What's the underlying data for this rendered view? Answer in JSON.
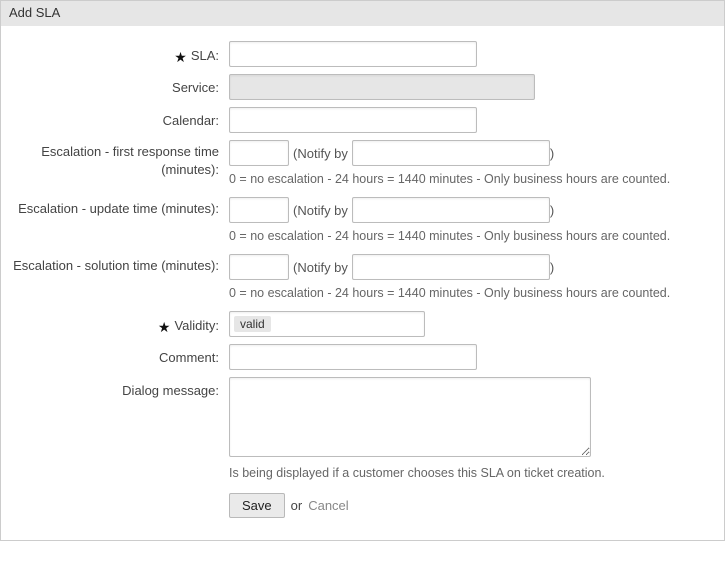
{
  "header": {
    "title": "Add SLA"
  },
  "labels": {
    "sla": "SLA:",
    "service": "Service:",
    "calendar": "Calendar:",
    "esc_first": "Escalation - first response time (minutes):",
    "esc_update": "Escalation - update time (minutes):",
    "esc_solution": "Escalation - solution time (minutes):",
    "validity": "Validity:",
    "comment": "Comment:",
    "dialog_message": "Dialog message:"
  },
  "values": {
    "sla": "",
    "service": "",
    "calendar": "",
    "esc_first_minutes": "",
    "esc_first_notify": "",
    "esc_update_minutes": "",
    "esc_update_notify": "",
    "esc_solution_minutes": "",
    "esc_solution_notify": "",
    "validity": "valid",
    "comment": "",
    "dialog_message": ""
  },
  "inline": {
    "notify_open": "(",
    "notify_label": "Notify by",
    "notify_close": ")"
  },
  "help": {
    "escalation": "0 = no escalation - 24 hours = 1440 minutes - Only business hours are counted.",
    "dialog_message": "Is being displayed if a customer chooses this SLA on ticket creation."
  },
  "actions": {
    "save": "Save",
    "or": "or",
    "cancel": "Cancel"
  },
  "required_marker": "★"
}
